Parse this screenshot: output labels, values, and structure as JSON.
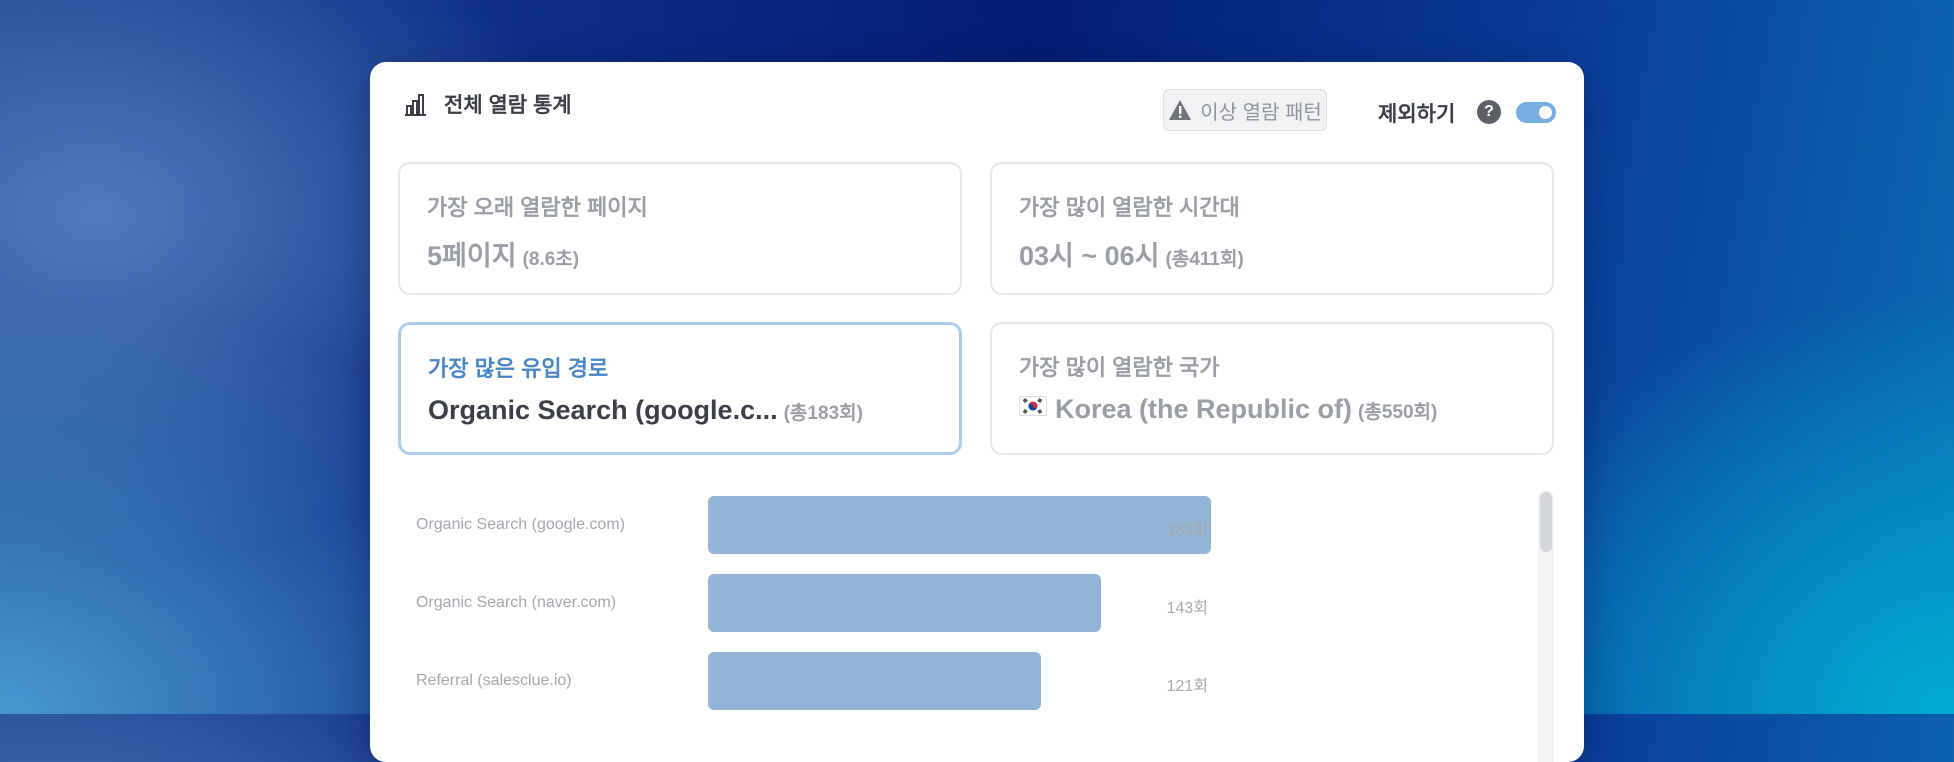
{
  "header": {
    "title": "전체 열람 통계",
    "pattern_button": "이상 열람 패턴",
    "exclude_label": "제외하기",
    "help": "?",
    "toggle_on": true
  },
  "cards": [
    {
      "label": "가장 오래 열람한 페이지",
      "value": "5페이지",
      "sub": "(8.6초)"
    },
    {
      "label": "가장 많이 열람한 시간대",
      "value": "03시 ~ 06시",
      "sub": "(총411회)"
    },
    {
      "label": "가장 많은 유입 경로",
      "value": "Organic Search (google.c...",
      "sub": "(총183회)"
    },
    {
      "label": "가장 많이 열람한 국가",
      "value": "Korea (the Republic of)",
      "sub": "(총550회)"
    }
  ],
  "colors": {
    "accent": "#4a86c5",
    "bar": "#93b6d6",
    "toggle": "#7aaee0"
  },
  "chart_data": {
    "type": "bar",
    "orientation": "horizontal",
    "categories": [
      "Organic Search (google.com)",
      "Organic Search (naver.com)",
      "Referral (salesclue.io)"
    ],
    "values": [
      183,
      143,
      121
    ],
    "value_labels": [
      "183회",
      "143회",
      "121회"
    ]
  }
}
